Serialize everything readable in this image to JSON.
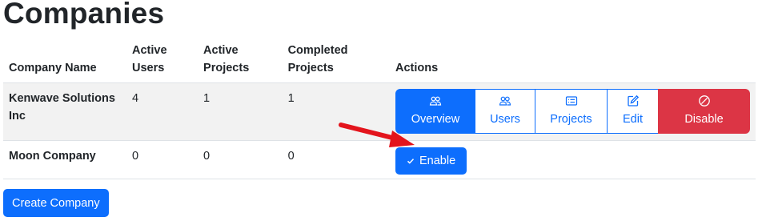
{
  "page": {
    "title": "Companies"
  },
  "table": {
    "headers": {
      "name": "Company Name",
      "active_users": [
        "Active",
        "Users"
      ],
      "active_projects": [
        "Active",
        "Projects"
      ],
      "completed_projects": [
        "Completed",
        "Projects"
      ],
      "actions": "Actions"
    },
    "rows": [
      {
        "name": "Kenwave Solutions Inc",
        "active_users": "4",
        "active_projects": "1",
        "completed_projects": "1",
        "actions": {
          "overview": "Overview",
          "users": "Users",
          "projects": "Projects",
          "edit": "Edit",
          "disable": "Disable"
        }
      },
      {
        "name": "Moon Company",
        "active_users": "0",
        "active_projects": "0",
        "completed_projects": "0",
        "actions": {
          "enable": "Enable"
        }
      }
    ]
  },
  "create_button": "Create Company",
  "colors": {
    "primary": "#0d6efd",
    "danger": "#dc3545",
    "annotation_arrow": "#e3141c"
  },
  "icons": {
    "overview": "people-icon",
    "users": "people-icon",
    "projects": "card-list-icon",
    "edit": "pencil-square-icon",
    "disable": "slash-circle-icon",
    "enable": "check-icon"
  }
}
